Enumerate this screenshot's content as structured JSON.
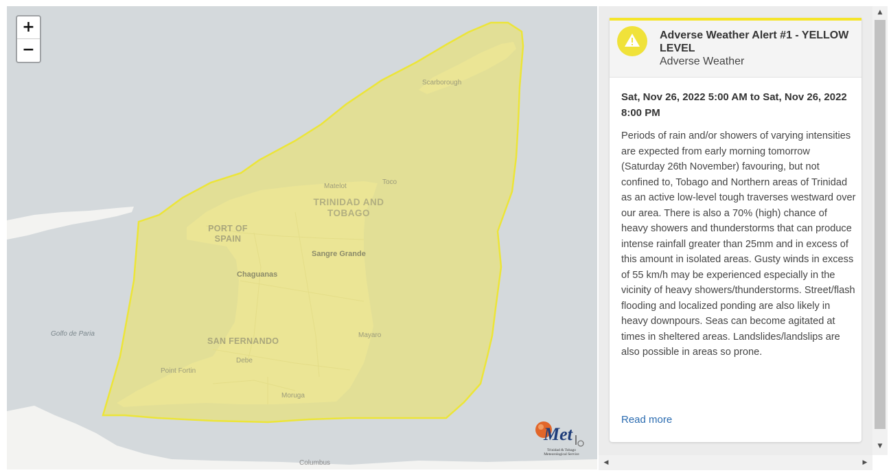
{
  "map": {
    "zoom_in": "+",
    "zoom_out": "−",
    "labels": {
      "scarborough": "Scarborough",
      "matelot": "Matelot",
      "toco": "Toco",
      "country_line1": "TRINIDAD AND",
      "country_line2": "TOBAGO",
      "port_of_spain_line1": "PORT OF",
      "port_of_spain_line2": "SPAIN",
      "sangre_grande": "Sangre Grande",
      "chaguanas": "Chaguanas",
      "golfo": "Golfo de Paria",
      "san_fernando": "SAN FERNANDO",
      "mayaro": "Mayaro",
      "debe": "Debe",
      "point_fortin": "Point Fortin",
      "moruga": "Moruga",
      "columbus": "Columbus"
    },
    "alert_area_color": "#e8e07c",
    "alert_border_color": "#ece538",
    "logo": {
      "letters": "Met",
      "caption_line1": "Trinidad & Tobago",
      "caption_line2": "Meteorological Service"
    }
  },
  "alert": {
    "title": "Adverse Weather Alert #1 - YELLOW LEVEL",
    "category": "Adverse Weather",
    "icon": "warning-icon",
    "level_color": "#f5e52a",
    "dates": "Sat, Nov 26, 2022 5:00 AM to Sat, Nov 26, 2022 8:00 PM",
    "description": "Periods of rain and/or showers of varying intensities are expected from early morning tomorrow (Saturday 26th November) favouring, but not confined to, Tobago and Northern areas of Trinidad as an active low-level tough traverses westward over our area. There is also a 70% (high) chance of heavy showers and thunderstorms that can produce intense rainfall greater than 25mm and in excess of this amount in isolated areas. Gusty winds in excess of 55 km/h may be experienced especially in the vicinity of heavy showers/thunderstorms. Street/flash flooding and localized ponding are also likely in heavy downpours. Seas can become agitated at times in sheltered areas. Landslides/landslips are also possible in areas so prone.",
    "read_more": "Read more"
  },
  "scrollbar": {
    "up_icon": "▲",
    "down_icon": "▼",
    "left_icon": "◀",
    "right_icon": "▶"
  }
}
